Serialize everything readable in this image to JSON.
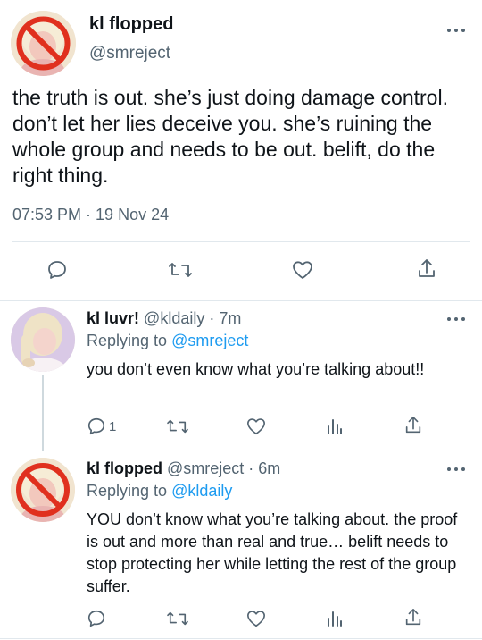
{
  "main_tweet": {
    "display_name": "kl flopped",
    "handle": "@smreject",
    "text": "the truth is out. she’s just doing damage control. don’t let her lies deceive you. she’s ruining the whole group and needs to be out. belift, do the right thing.",
    "timestamp": "07:53 PM · 19 Nov 24",
    "actions": [
      "reply-icon",
      "retweet-icon",
      "like-icon",
      "share-icon"
    ]
  },
  "replies": [
    {
      "display_name": "kl luvr!",
      "handle_time": "@kldaily · 7m",
      "replying_prefix": "Replying to ",
      "replying_to": "@smreject",
      "text": "you don’t even know what you’re talking about!!",
      "reply_count": "1",
      "actions": [
        "reply-icon",
        "retweet-icon",
        "like-icon",
        "analytics-icon",
        "share-icon"
      ]
    },
    {
      "display_name": "kl flopped",
      "handle_time": "@smreject · 6m",
      "replying_prefix": "Replying to ",
      "replying_to": "@kldaily",
      "text": "YOU don’t know what you’re talking about. the proof is out and more than real and true… belift needs to stop protecting her while letting the rest of the group suffer.",
      "reply_count": "",
      "actions": [
        "reply-icon",
        "retweet-icon",
        "like-icon",
        "analytics-icon",
        "share-icon"
      ]
    }
  ],
  "colors": {
    "accent": "#1d9bf0",
    "muted": "#536471",
    "text": "#0f1419",
    "no_sign": "#e0301e"
  }
}
